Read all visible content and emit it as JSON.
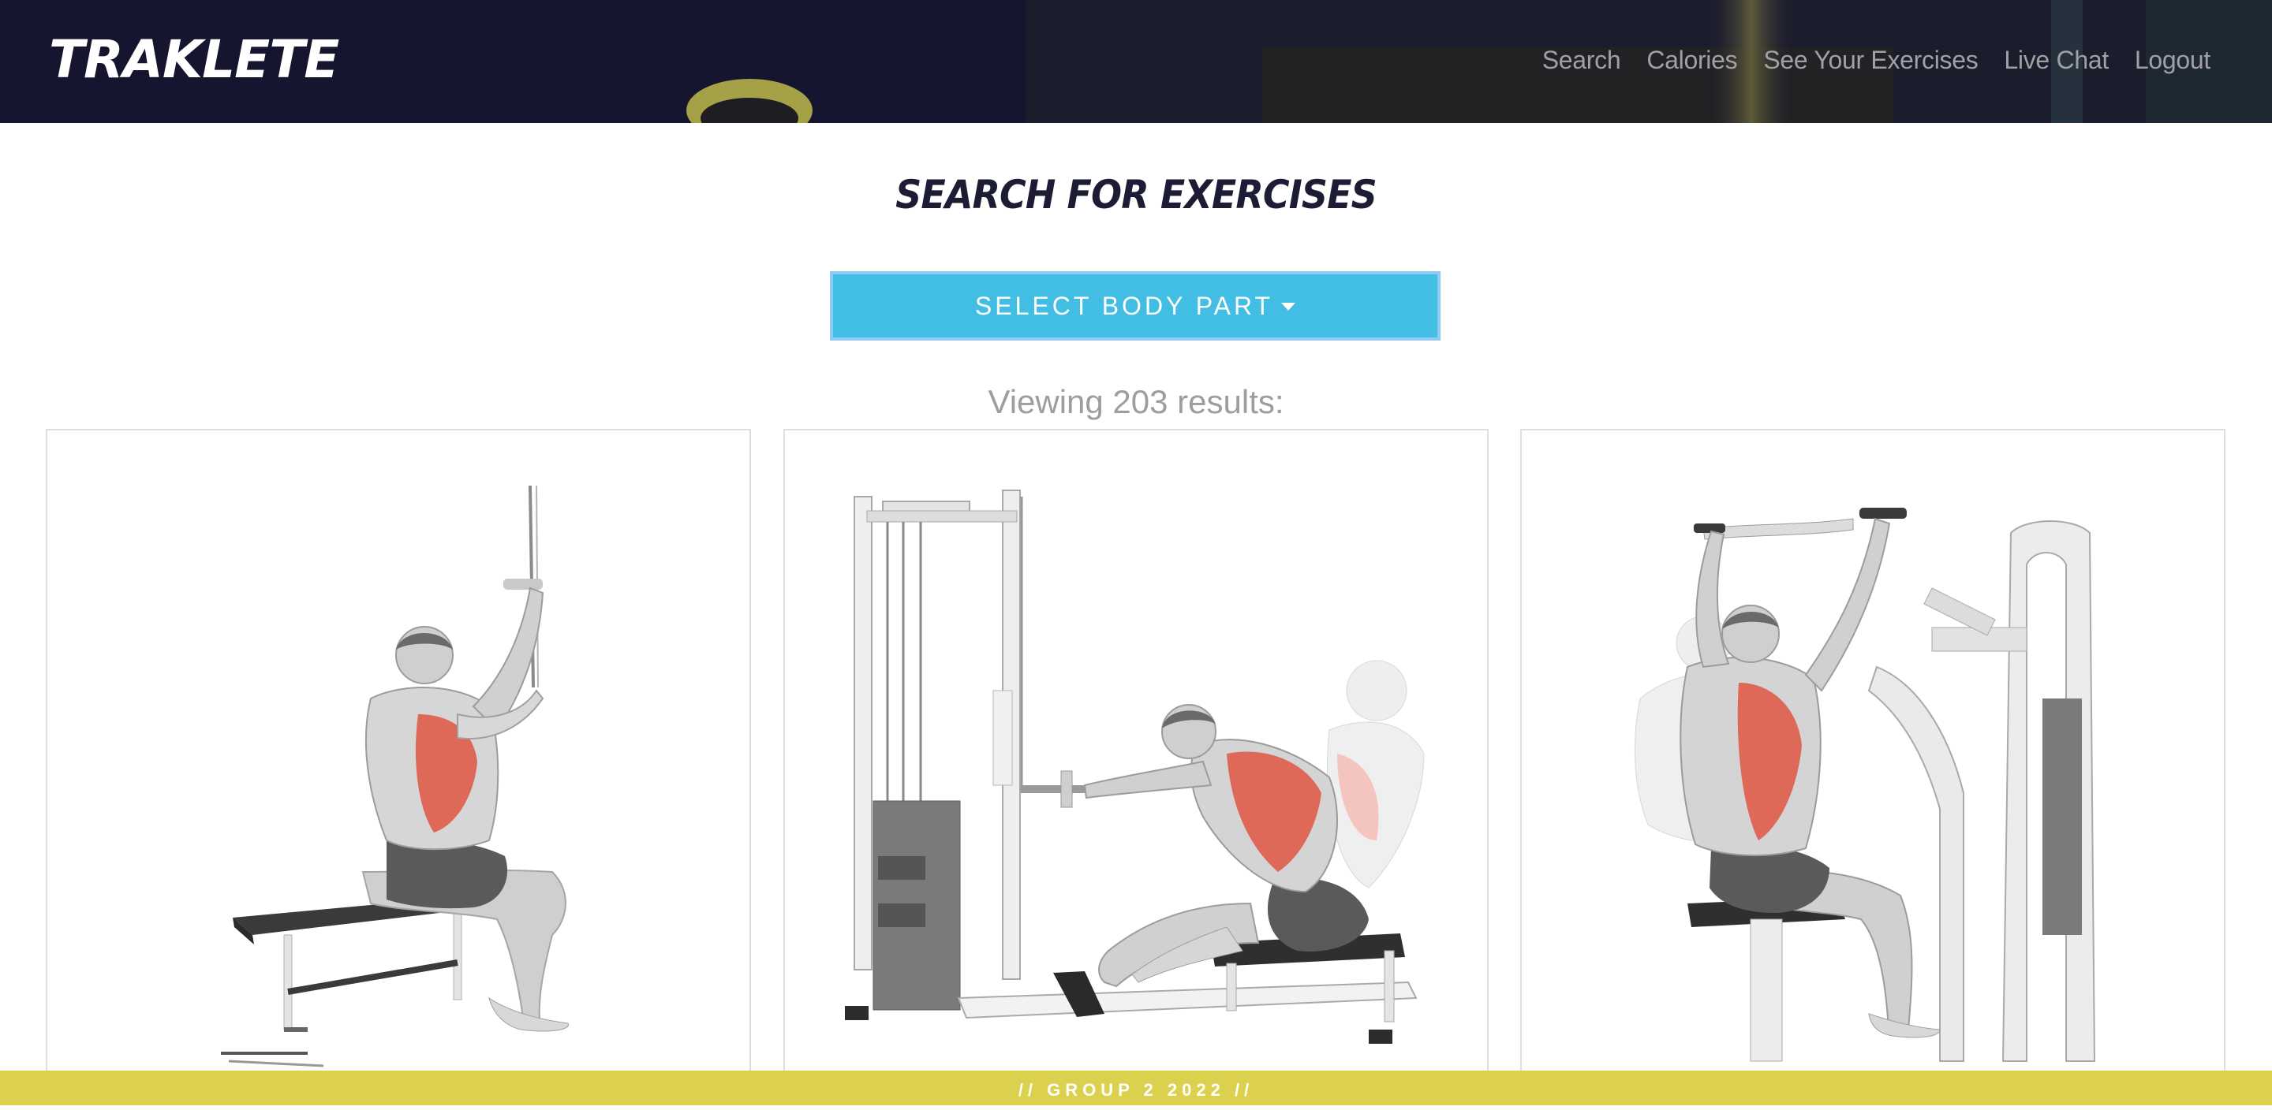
{
  "brand": "TRAKLETE",
  "nav": {
    "items": [
      {
        "label": "Search"
      },
      {
        "label": "Calories"
      },
      {
        "label": "See Your Exercises"
      },
      {
        "label": "Live Chat"
      },
      {
        "label": "Logout"
      }
    ]
  },
  "page": {
    "title": "SEARCH FOR EXERCISES",
    "select_label": "SELECT BODY PART",
    "results_text": "Viewing 203 results:"
  },
  "cards": [
    {
      "icon": "lat-pulldown-exercise-illustration"
    },
    {
      "icon": "seated-cable-row-exercise-illustration"
    },
    {
      "icon": "machine-lat-pulldown-exercise-illustration"
    }
  ],
  "footer": "// GROUP 2 2022 //",
  "colors": {
    "header_bg": "#151530",
    "button_bg": "#42bde3",
    "button_border": "#8fcaf4",
    "footer_bg": "#dcd14e",
    "title": "#1c1c34",
    "muscle_highlight": "#e05a48"
  }
}
